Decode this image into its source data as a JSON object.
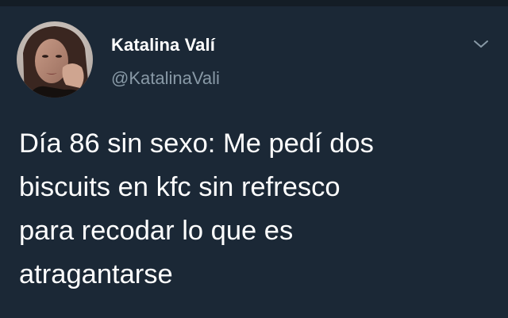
{
  "tweet": {
    "author": {
      "display_name": "Katalina Valí",
      "handle": "@KatalinaVali",
      "avatar_icon": "profile-photo"
    },
    "menu_icon": "chevron-down-icon",
    "text": "Día 86 sin sexo: Me pedí dos\nbiscuits en kfc sin refresco\npara recodar lo que es\natragantarse"
  },
  "colors": {
    "background": "#1b2836",
    "text_primary": "#ffffff",
    "text_secondary": "#8899a6",
    "icon": "#8899a6"
  }
}
